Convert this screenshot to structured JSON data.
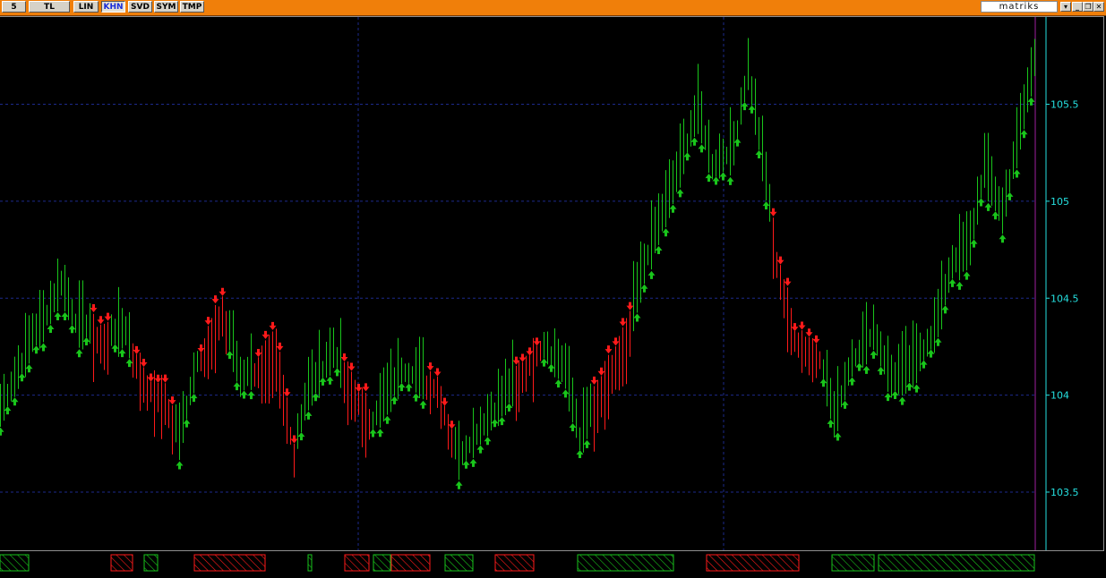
{
  "toolbar": {
    "buttons": [
      {
        "id": "period",
        "label": "5"
      },
      {
        "id": "tl",
        "label": "TL"
      },
      {
        "id": "lin",
        "label": "LIN"
      },
      {
        "id": "khn",
        "label": "KHN",
        "active": true
      },
      {
        "id": "svd",
        "label": "SVD"
      },
      {
        "id": "sym",
        "label": "SYM"
      },
      {
        "id": "tmp",
        "label": "TMP"
      }
    ],
    "brand": "matriks",
    "color": "#f07f0a"
  },
  "chart_data": {
    "type": "bar",
    "ylim": [
      103.2,
      105.95
    ],
    "yticks": [
      103.5,
      104,
      104.5,
      105,
      105.5
    ],
    "ytick_labels": [
      "103.5",
      "104",
      "104.5",
      "105",
      "105.5"
    ],
    "grid": true,
    "colors": {
      "up": "#19c51b",
      "down": "#ff1a1a",
      "grid": "#1d2a8c",
      "axis": "#25e0e0",
      "marker": "#a020a0"
    },
    "x_count": 232,
    "key_points": [
      {
        "i": 0,
        "v": 103.9
      },
      {
        "i": 8,
        "v": 104.05
      },
      {
        "i": 18,
        "v": 104.28
      },
      {
        "i": 24,
        "v": 104.35
      },
      {
        "i": 34,
        "v": 104.55
      },
      {
        "i": 42,
        "v": 104.35
      },
      {
        "i": 58,
        "v": 104.3
      },
      {
        "i": 70,
        "v": 104.3
      },
      {
        "i": 82,
        "v": 104.05
      },
      {
        "i": 92,
        "v": 104.0
      },
      {
        "i": 100,
        "v": 103.75
      },
      {
        "i": 110,
        "v": 104.15
      },
      {
        "i": 124,
        "v": 104.45
      },
      {
        "i": 134,
        "v": 104.05
      },
      {
        "i": 154,
        "v": 104.25
      },
      {
        "i": 164,
        "v": 103.7
      },
      {
        "i": 172,
        "v": 104.0
      },
      {
        "i": 186,
        "v": 104.2
      },
      {
        "i": 196,
        "v": 104.05
      },
      {
        "i": 208,
        "v": 103.85
      },
      {
        "i": 224,
        "v": 104.1
      },
      {
        "i": 244,
        "v": 104.05
      },
      {
        "i": 256,
        "v": 103.65
      },
      {
        "i": 268,
        "v": 103.8
      },
      {
        "i": 280,
        "v": 103.95
      },
      {
        "i": 290,
        "v": 104.1
      },
      {
        "i": 302,
        "v": 104.25
      },
      {
        "i": 316,
        "v": 104.1
      },
      {
        "i": 324,
        "v": 103.75
      },
      {
        "i": 334,
        "v": 104.0
      },
      {
        "i": 350,
        "v": 104.3
      },
      {
        "i": 362,
        "v": 104.7
      },
      {
        "i": 376,
        "v": 105.05
      },
      {
        "i": 390,
        "v": 105.45
      },
      {
        "i": 398,
        "v": 105.15
      },
      {
        "i": 410,
        "v": 105.25
      },
      {
        "i": 418,
        "v": 105.65
      },
      {
        "i": 426,
        "v": 105.2
      },
      {
        "i": 434,
        "v": 104.7
      },
      {
        "i": 444,
        "v": 104.3
      },
      {
        "i": 458,
        "v": 104.2
      },
      {
        "i": 466,
        "v": 103.85
      },
      {
        "i": 476,
        "v": 104.15
      },
      {
        "i": 488,
        "v": 104.3
      },
      {
        "i": 498,
        "v": 104.05
      },
      {
        "i": 512,
        "v": 104.15
      },
      {
        "i": 522,
        "v": 104.3
      },
      {
        "i": 532,
        "v": 104.65
      },
      {
        "i": 542,
        "v": 104.75
      },
      {
        "i": 550,
        "v": 105.15
      },
      {
        "i": 560,
        "v": 104.9
      },
      {
        "i": 570,
        "v": 105.35
      },
      {
        "i": 578,
        "v": 105.7
      }
    ],
    "segments": [
      {
        "from": 0,
        "to": 52,
        "trend": "up"
      },
      {
        "from": 52,
        "to": 62,
        "trend": "down"
      },
      {
        "from": 62,
        "to": 74,
        "trend": "up"
      },
      {
        "from": 74,
        "to": 97,
        "trend": "down"
      },
      {
        "from": 97,
        "to": 111,
        "trend": "up"
      },
      {
        "from": 111,
        "to": 127,
        "trend": "down"
      },
      {
        "from": 127,
        "to": 142,
        "trend": "up"
      },
      {
        "from": 142,
        "to": 166,
        "trend": "down"
      },
      {
        "from": 166,
        "to": 191,
        "trend": "up"
      },
      {
        "from": 191,
        "to": 207,
        "trend": "down"
      },
      {
        "from": 207,
        "to": 237,
        "trend": "up"
      },
      {
        "from": 237,
        "to": 254,
        "trend": "down"
      },
      {
        "from": 254,
        "to": 287,
        "trend": "up"
      },
      {
        "from": 287,
        "to": 304,
        "trend": "down"
      },
      {
        "from": 304,
        "to": 331,
        "trend": "up"
      },
      {
        "from": 331,
        "to": 353,
        "trend": "down"
      },
      {
        "from": 353,
        "to": 431,
        "trend": "up"
      },
      {
        "from": 431,
        "to": 459,
        "trend": "down"
      },
      {
        "from": 459,
        "to": 580,
        "trend": "up"
      }
    ]
  },
  "bottom_bands": [
    {
      "from": 0,
      "to": 32,
      "trend": "up"
    },
    {
      "from": 124,
      "to": 148,
      "trend": "down"
    },
    {
      "from": 161,
      "to": 176,
      "trend": "up"
    },
    {
      "from": 217,
      "to": 296,
      "trend": "down"
    },
    {
      "from": 344,
      "to": 348,
      "trend": "up"
    },
    {
      "from": 385,
      "to": 412,
      "trend": "down"
    },
    {
      "from": 417,
      "to": 436,
      "trend": "up"
    },
    {
      "from": 437,
      "to": 480,
      "trend": "down"
    },
    {
      "from": 497,
      "to": 528,
      "trend": "up"
    },
    {
      "from": 553,
      "to": 596,
      "trend": "down"
    },
    {
      "from": 645,
      "to": 752,
      "trend": "up"
    },
    {
      "from": 789,
      "to": 892,
      "trend": "down"
    },
    {
      "from": 929,
      "to": 976,
      "trend": "up"
    },
    {
      "from": 981,
      "to": 1155,
      "trend": "up"
    }
  ]
}
